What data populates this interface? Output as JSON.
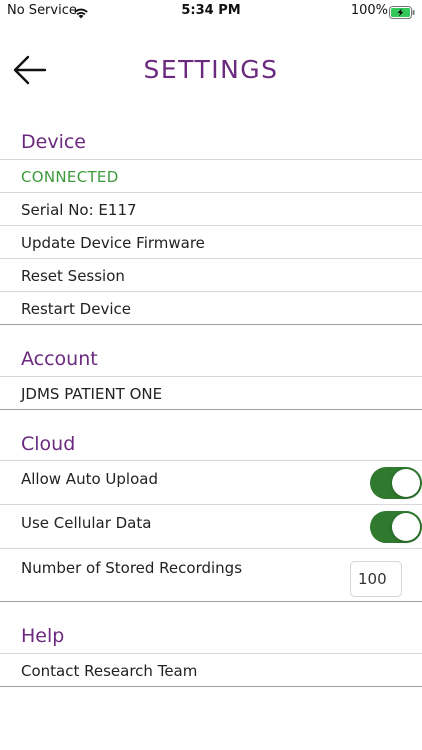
{
  "status_bar": {
    "carrier": "No Service",
    "time": "5:34 PM",
    "battery": "100%"
  },
  "header": {
    "title": "SETTINGS"
  },
  "sections": {
    "device": {
      "header": "Device",
      "status": "CONNECTED",
      "serial": "Serial No: E117",
      "update_firmware": "Update Device Firmware",
      "reset_session": "Reset Session",
      "restart_device": "Restart Device"
    },
    "account": {
      "header": "Account",
      "patient_name": "JDMS PATIENT ONE"
    },
    "cloud": {
      "header": "Cloud",
      "auto_upload_label": "Allow Auto Upload",
      "auto_upload_on": true,
      "cellular_label": "Use Cellular Data",
      "cellular_on": true,
      "stored_recordings_label": "Number of Stored Recordings",
      "stored_recordings_value": "100"
    },
    "help": {
      "header": "Help",
      "contact": "Contact Research Team"
    }
  },
  "colors": {
    "accent": "#6b2a7f",
    "connected": "#3c9a3c",
    "toggle_on": "#2f7a2f"
  }
}
